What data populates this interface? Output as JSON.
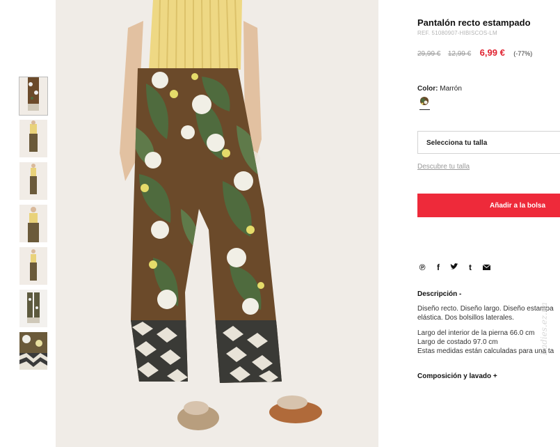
{
  "product": {
    "title": "Pantalón recto estampado",
    "ref": "REF. 51080907-HIBISCOS-LM",
    "price_original": "29,99 €",
    "price_previous": "12,99 €",
    "price_current": "6,99 €",
    "discount": "(-77%)"
  },
  "color": {
    "label": "Color:",
    "value": "Marrón"
  },
  "size": {
    "select_label": "Selecciona tu talla",
    "guide_link": "Descubre tu talla"
  },
  "cart": {
    "add_label": "Añadir a la bolsa"
  },
  "share": {
    "icons": [
      "pinterest-icon",
      "facebook-icon",
      "twitter-icon",
      "tumblr-icon",
      "email-icon"
    ],
    "glyphs": [
      "℗",
      "f",
      "✔",
      "t",
      "✉"
    ]
  },
  "description": {
    "title": "Descripción -",
    "line1": "Diseño recto. Diseño largo. Diseño estampa",
    "line2": "elástica. Dos bolsillos laterales.",
    "line3": "Largo del interior de la pierna 66.0 cm",
    "line4": "Largo de costado 97.0 cm",
    "line5": "Estas medidas están calculadas para una ta"
  },
  "composition": {
    "title": "Composición y lavado +"
  },
  "watermark": "Ladies.ez.ua",
  "colors": {
    "accent": "#ee2a3a",
    "sale_price": "#e0212f",
    "pant_base": "#6b4a2a",
    "leaf_green": "#4f6b3e",
    "top_yellow": "#e9d27a"
  }
}
